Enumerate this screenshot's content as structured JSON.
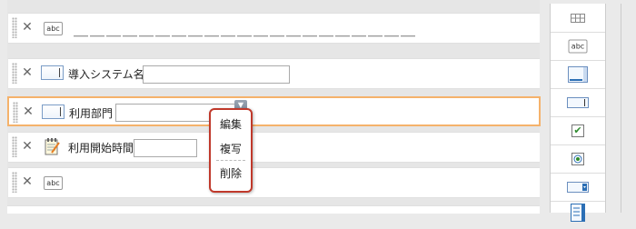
{
  "rows": [
    {
      "delete_icon": "✕",
      "type_icon": "abc",
      "content": "＿＿＿＿＿＿＿＿＿＿＿＿＿＿＿＿＿＿＿＿＿"
    },
    {
      "delete_icon": "✕",
      "label": "導入システム名",
      "value": ""
    },
    {
      "delete_icon": "✕",
      "label": "利用部門",
      "value": ""
    },
    {
      "delete_icon": "✕",
      "label": "利用開始時間",
      "value": ""
    },
    {
      "delete_icon": "✕",
      "type_icon": "abc"
    }
  ],
  "field_menu_button": "▼",
  "context_menu": {
    "edit": "編集",
    "copy": "複写",
    "delete": "削除"
  },
  "palette": {
    "items": [
      {
        "name": "grid-icon"
      },
      {
        "name": "label-icon",
        "text": "abc"
      },
      {
        "name": "textarea-icon"
      },
      {
        "name": "textbox-icon"
      },
      {
        "name": "checkbox-icon",
        "check": "✔"
      },
      {
        "name": "radio-icon"
      },
      {
        "name": "dropdown-icon"
      },
      {
        "name": "list-icon"
      }
    ]
  }
}
